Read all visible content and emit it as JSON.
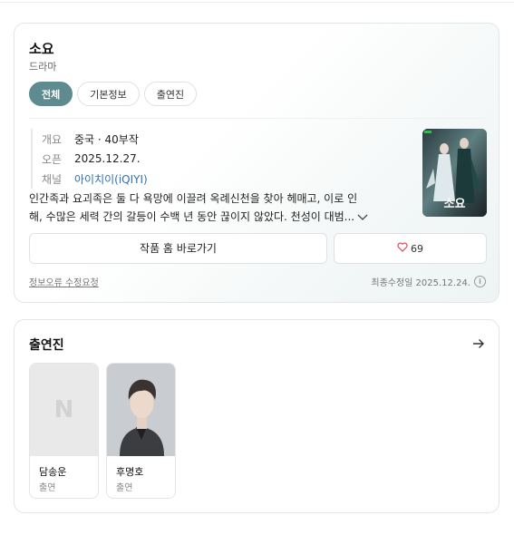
{
  "work": {
    "title": "소요",
    "genre": "드라마",
    "tabs": [
      {
        "label": "전체",
        "active": true
      },
      {
        "label": "기본정보",
        "active": false
      },
      {
        "label": "출연진",
        "active": false
      }
    ],
    "info": [
      {
        "key": "개요",
        "value": "중국 · 40부작"
      },
      {
        "key": "오픈",
        "value": "2025.12.27."
      },
      {
        "key": "채널",
        "value": "아이치이(iQIYI)"
      }
    ],
    "poster_text": "소요",
    "description_line1": "인간족과 요괴족은 둘 다 욕망에 이끌려 옥례신천을 찾아 헤매고, 이로 인",
    "description_line2": "해, 수많은 세력 간의 갈등이 수백 년 동안 끊이지 않았다. 천성이 대범...",
    "home_button": "작품 홈 바로가기",
    "like_count": "69",
    "report_link": "정보오류 수정요청",
    "updated": "최종수정일 2025.12.24."
  },
  "cast_section": {
    "title": "출연진",
    "placeholder_letter": "N",
    "members": [
      {
        "name": "담송운",
        "role": "출연"
      },
      {
        "name": "후명호",
        "role": "출연"
      }
    ]
  },
  "icons": {
    "more": "chevron-down-icon",
    "like": "heart-icon",
    "info": "info-icon",
    "arrow": "arrow-right-icon"
  },
  "colors": {
    "accent": "#5d8b8f",
    "link": "#2e6fb6",
    "heart": "#e0474c"
  }
}
